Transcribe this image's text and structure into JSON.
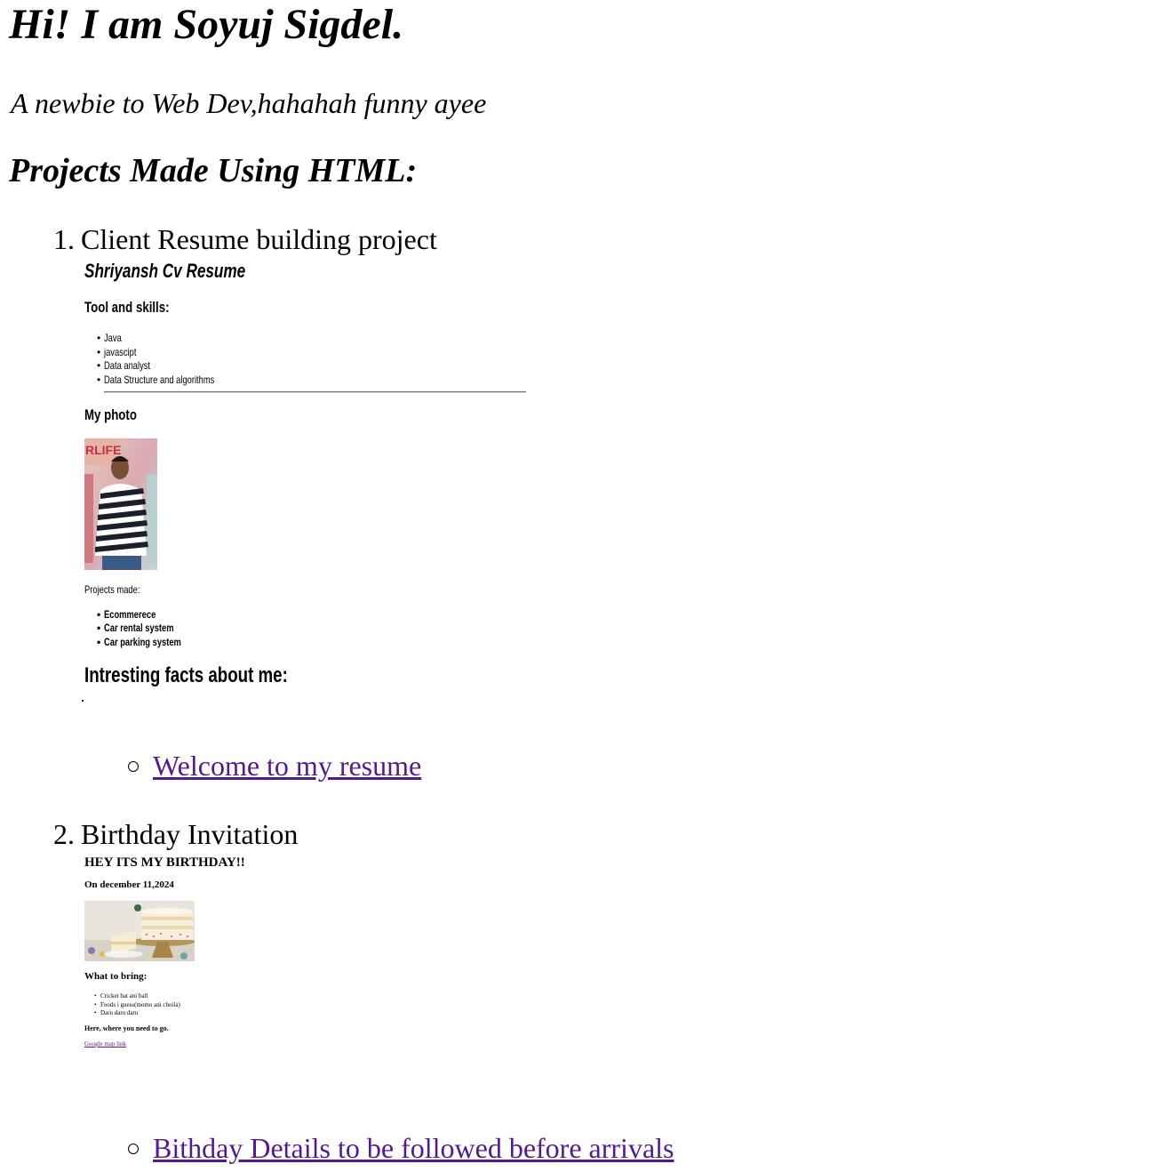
{
  "header": {
    "title": "Hi! I am Soyuj Sigdel.",
    "subtitle": "A newbie to Web Dev,hahahah funny ayee"
  },
  "projects": {
    "heading": "Projects Made Using HTML:",
    "items": [
      {
        "number": "1.",
        "title": "Client Resume building project",
        "preview": {
          "title": "Shriyansh Cv Resume",
          "skills_heading": "Tool and skills:",
          "skills": [
            "Java",
            "javascipt",
            "Data analyst",
            "Data Structure and algorithms"
          ],
          "photo_heading": "My photo",
          "projects_label": "Projects made:",
          "projects": [
            "Ecommerece",
            "Car rental system",
            "Car parking system"
          ],
          "facts_heading": "Intresting facts about me:"
        },
        "link": "Welcome to my resume"
      },
      {
        "number": "2.",
        "title": "Birthday Invitation",
        "preview": {
          "title": "HEY ITS MY BIRTHDAY!!",
          "date": "On december 11,2024",
          "bring_heading": "What to bring:",
          "bring_items": [
            "Cricket bat ani ball",
            "Foods i guess(momo ani choila)",
            "Daru daru daru"
          ],
          "where_text": "Here, where you need to go.",
          "map_link": "Google map link"
        },
        "link": "Bithday Details to be followed before arrivals"
      }
    ]
  },
  "colors": {
    "link_visited": "#551a8b",
    "text": "#000000",
    "background": "#ffffff"
  }
}
